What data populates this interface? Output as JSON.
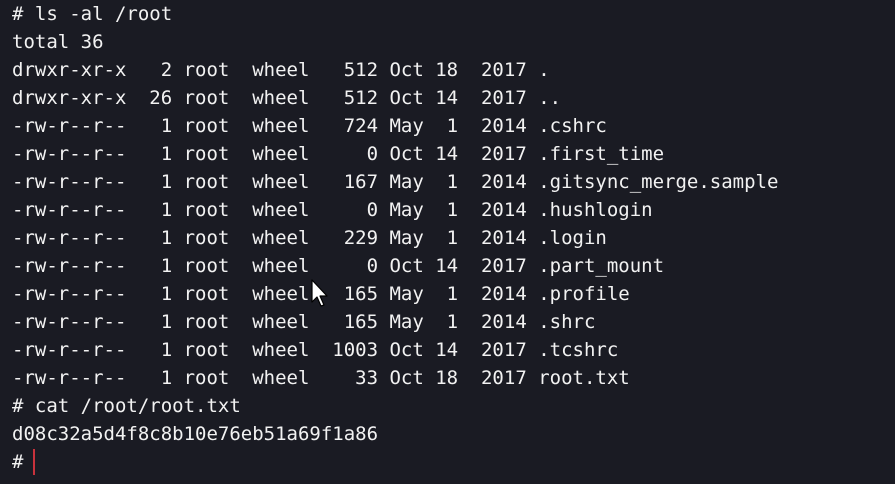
{
  "terminal": {
    "lines": [
      "# ls -al /root",
      "total 36",
      "drwxr-xr-x   2 root  wheel   512 Oct 18  2017 .",
      "drwxr-xr-x  26 root  wheel   512 Oct 14  2017 ..",
      "-rw-r--r--   1 root  wheel   724 May  1  2014 .cshrc",
      "-rw-r--r--   1 root  wheel     0 Oct 14  2017 .first_time",
      "-rw-r--r--   1 root  wheel   167 May  1  2014 .gitsync_merge.sample",
      "-rw-r--r--   1 root  wheel     0 May  1  2014 .hushlogin",
      "-rw-r--r--   1 root  wheel   229 May  1  2014 .login",
      "-rw-r--r--   1 root  wheel     0 Oct 14  2017 .part_mount",
      "-rw-r--r--   1 root  wheel   165 May  1  2014 .profile",
      "-rw-r--r--   1 root  wheel   165 May  1  2014 .shrc",
      "-rw-r--r--   1 root  wheel  1003 Oct 14  2017 .tcshrc",
      "-rw-r--r--   1 root  wheel    33 Oct 18  2017 root.txt",
      "# cat /root/root.txt",
      "d08c32a5d4f8c8b10e76eb51a69f1a86"
    ],
    "prompt": "#",
    "colors": {
      "background": "#1a1b23",
      "text": "#f2f2f2",
      "caret": "#c8323c"
    },
    "icons": {
      "pointer": "mouse-pointer-icon"
    }
  }
}
